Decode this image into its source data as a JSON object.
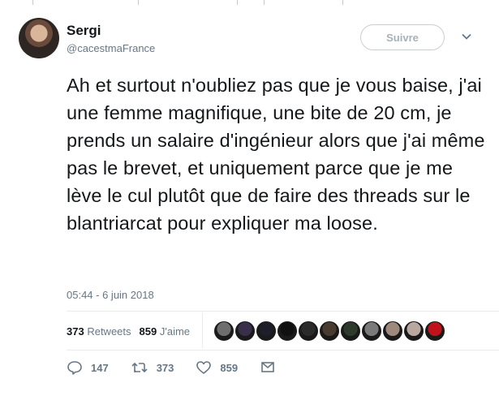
{
  "author": {
    "name": "Sergi",
    "handle": "@cacestmaFrance"
  },
  "follow_button": {
    "label": "Suivre"
  },
  "tweet": {
    "text": "Ah et surtout n'oubliez pas que je vous baise, j'ai une femme magnifique, une bite de 20 cm, je prends un salaire d'ingénieur alors que j'ai même pas le brevet, et uniquement parce que je me lève le cul plutôt que de faire des threads sur le blantriarcat pour expliquer ma loose.",
    "timestamp": "05:44 - 6 juin 2018"
  },
  "stats": {
    "retweets_count": "373",
    "retweets_label": "Retweets",
    "likes_count": "859",
    "likes_label": "J'aime"
  },
  "likers": [
    {
      "color": "#6e6e6e"
    },
    {
      "color": "#3a2f4a"
    },
    {
      "color": "#1e1e2a"
    },
    {
      "color": "#101010"
    },
    {
      "color": "#2b2b2b"
    },
    {
      "color": "#4a3b30"
    },
    {
      "color": "#2e3a2c"
    },
    {
      "color": "#7a7a7a"
    },
    {
      "color": "#9d8a7c"
    },
    {
      "color": "#b9a8a0"
    },
    {
      "color": "#c0121a"
    }
  ],
  "actions": {
    "reply_count": "147",
    "retweet_count": "373",
    "like_count": "859"
  },
  "colors": {
    "text": "#14171a",
    "secondary": "#657786",
    "border": "#e6ecf0"
  },
  "icons": [
    "chevron-down-icon",
    "reply-icon",
    "retweet-icon",
    "like-icon",
    "message-icon"
  ]
}
